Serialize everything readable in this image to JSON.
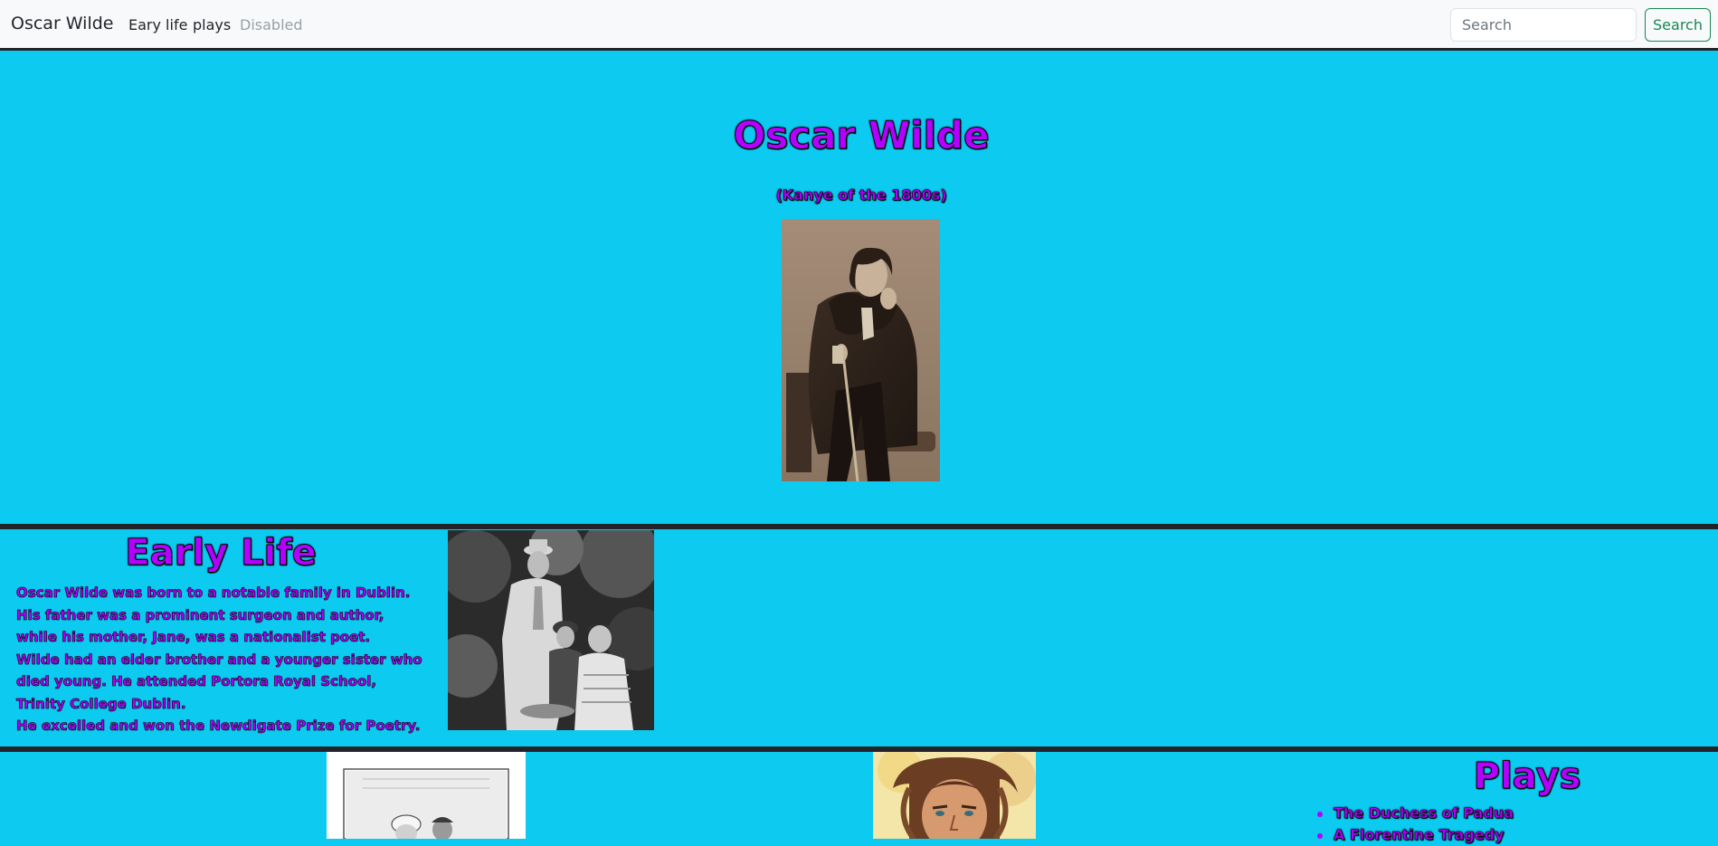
{
  "navbar": {
    "brand": "Oscar Wilde",
    "links": [
      {
        "label": "Eary life",
        "disabled": false
      },
      {
        "label": "plays",
        "disabled": false
      },
      {
        "label": "Disabled",
        "disabled": true
      }
    ],
    "search": {
      "placeholder": "Search",
      "value": "",
      "button_label": "Search"
    }
  },
  "hero": {
    "title": "Oscar Wilde",
    "subtitle": "(Kanye of the 1800s)"
  },
  "early_life": {
    "title": "Early Life",
    "paragraphs": [
      "Oscar Wilde was born to a notable family in Dublin. His father was a prominent surgeon and author, while his mother, Jane, was a nationalist poet.",
      "Wilde had an elder brother and a younger sister who died young. He attended Portora Royal School, Trinity College Dublin.",
      "He excelled and won the Newdigate Prize for Poetry."
    ]
  },
  "plays": {
    "title": "Plays",
    "items": [
      "The Duchess of Padua",
      "A Florentine Tragedy"
    ]
  },
  "colors": {
    "page_background": "#0dcaf0",
    "heading_fill": "#b300ff",
    "outline": "#000000",
    "navbar_background": "#f8f9fa",
    "search_button": "#198754",
    "divider": "#212529"
  }
}
